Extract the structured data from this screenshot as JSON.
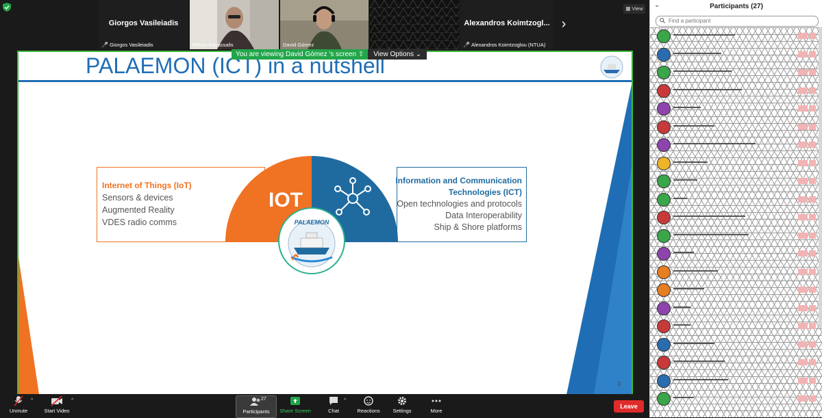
{
  "gallery": {
    "tiles": [
      {
        "name": "Giorgos Vasileiadis",
        "label": "Giorgos Vasileiadis",
        "muted": true
      },
      {
        "name": "",
        "label": "Petros Kavassalis",
        "muted": false
      },
      {
        "name": "",
        "label": "David Gómez",
        "muted": false
      },
      {
        "name": "",
        "label": "",
        "muted": false
      },
      {
        "name": "Alexandros Koimtzogl...",
        "label": "Alexandros Koimtzoglou (NTUA)",
        "muted": true
      }
    ],
    "view_label": "View"
  },
  "banner": {
    "message": "You are viewing David Gómez 's screen",
    "options_label": "View Options"
  },
  "slide": {
    "title": "PALAEMON (ICT) in a nutshell",
    "number": "3",
    "iot": {
      "heading": "Internet of Things (IoT)",
      "items": [
        "Sensors & devices",
        "Augmented Reality",
        "VDES radio comms"
      ]
    },
    "ict": {
      "heading_line1": "Information and Communication",
      "heading_line2": "Technologies (ICT)",
      "items": [
        "Open technologies and protocols",
        "Data Interoperability",
        "Ship & Shore platforms"
      ]
    },
    "gauge_text": "IOT",
    "logo_text": "PALAEMON",
    "colors": {
      "orange": "#f07223",
      "blue": "#1f6ba0",
      "title": "#1f6eb5"
    }
  },
  "participants": {
    "title": "Participants (27)",
    "search_placeholder": "Find a participant",
    "avatar_colors": [
      "#3aa64a",
      "#2a6cb0",
      "#3aa64a",
      "#c83a3a",
      "#8e44ad",
      "#c83a3a",
      "#8e44ad",
      "#f0b429",
      "#3aa64a",
      "#3aa64a",
      "#c83a3a",
      "#3aa64a",
      "#8e44ad",
      "#e67e22",
      "#e67e22",
      "#8e44ad",
      "#c83a3a",
      "#2a6cb0",
      "#c83a3a",
      "#2a6cb0",
      "#3aa64a"
    ]
  },
  "toolbar": {
    "unmute": "Unmute",
    "start_video": "Start Video",
    "participants": "Participants",
    "participants_count": "27",
    "share_screen": "Share Screen",
    "chat": "Chat",
    "reactions": "Reactions",
    "settings": "Settings",
    "more": "More",
    "leave": "Leave"
  }
}
